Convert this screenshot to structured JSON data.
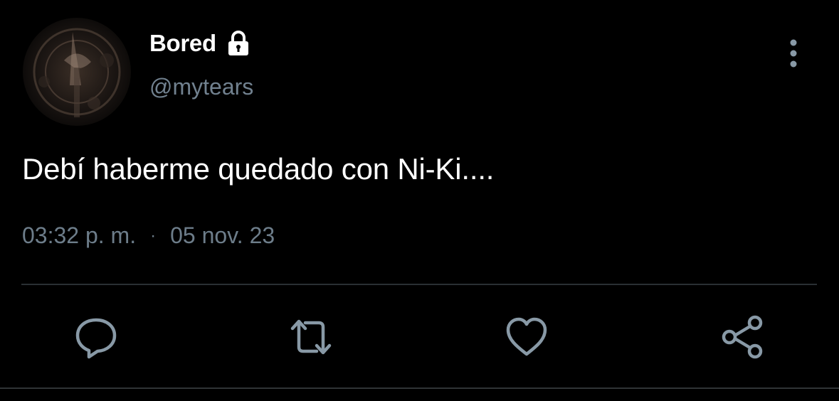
{
  "user": {
    "display_name": "Bored",
    "handle": "@mytears",
    "protected_icon": "lock-icon",
    "avatar_icon": "avatar-image"
  },
  "tweet": {
    "text": "Debí haberme quedado con Ni-Ki....",
    "time": "03:32 p. m.",
    "separator": "·",
    "date": "05 nov. 23"
  },
  "actions": {
    "reply_icon": "reply-icon",
    "retweet_icon": "retweet-icon",
    "like_icon": "heart-icon",
    "share_icon": "share-icon",
    "more_icon": "more-vertical-icon"
  },
  "colors": {
    "background": "#000000",
    "primary_text": "#ffffff",
    "secondary_text": "#71818f",
    "icon": "#8899a6",
    "divider": "#2f3336"
  }
}
